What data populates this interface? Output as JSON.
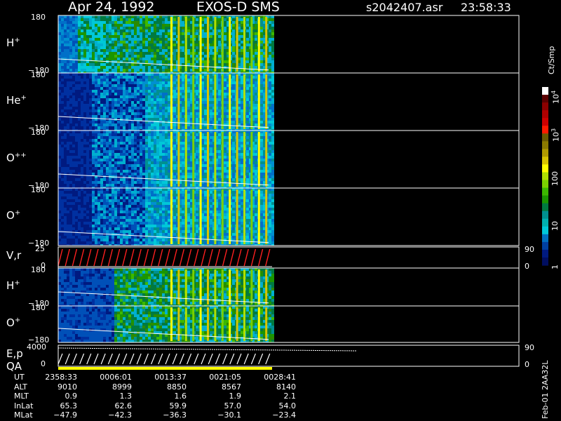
{
  "header": {
    "date": "Apr 24, 1992",
    "instrument": "EXOS-D SMS",
    "file": "s2042407.asr",
    "time": "23:58:33"
  },
  "chart_data": {
    "type": "heatmap",
    "panels": [
      {
        "label_base": "H",
        "label_sup": "+",
        "ytick_top": "180",
        "ytick_bottom": "−180",
        "style": "flux_green"
      },
      {
        "label_base": "He",
        "label_sup": "+",
        "ytick_top": "180",
        "ytick_bottom": "−180",
        "style": "flux_blue"
      },
      {
        "label_base": "O",
        "label_sup": "++",
        "ytick_top": "180",
        "ytick_bottom": "−180",
        "style": "flux_blue"
      },
      {
        "label_base": "O",
        "label_sup": "+",
        "ytick_top": "180",
        "ytick_bottom": "−180",
        "style": "flux_blue"
      },
      {
        "label_base": "V,r",
        "label_sup": "",
        "ytick_top": "25",
        "ytick_bottom": "0",
        "rtick_top": "90",
        "rtick_bottom": "0",
        "style": "line_red"
      },
      {
        "label_base": "H",
        "label_sup": "+",
        "ytick_top": "180",
        "ytick_bottom": "−180",
        "style": "flux_green_low"
      },
      {
        "label_base": "O",
        "label_sup": "+",
        "ytick_top": "180",
        "ytick_bottom": "−180",
        "style": "flux_green_low"
      },
      {
        "label_base": "E,p",
        "label2": "QA",
        "label_sup": "",
        "ytick_top": "4000",
        "ytick_bottom": "0",
        "rtick_top": "90",
        "rtick_bottom": "0",
        "style": "line_white"
      }
    ],
    "colorbar": {
      "unit": "Ct/Smp",
      "ticks": [
        {
          "base": "10",
          "exp": "4",
          "frac": 0.96
        },
        {
          "base": "10",
          "exp": "3",
          "frac": 0.75
        },
        {
          "base": "100",
          "exp": "",
          "frac": 0.5
        },
        {
          "base": "10",
          "exp": "",
          "frac": 0.25
        },
        {
          "base": "1",
          "exp": "",
          "frac": 0.03
        }
      ],
      "colors": [
        "#ffffff",
        "#5a0000",
        "#8b0000",
        "#b00000",
        "#d00000",
        "#ff1a00",
        "#6b5a00",
        "#8b7a00",
        "#b09a00",
        "#d8c400",
        "#ffff00",
        "#b0e000",
        "#7ad000",
        "#3cb800",
        "#1a9600",
        "#007a40",
        "#009090",
        "#00b0b0",
        "#00c8d8",
        "#0070c0",
        "#0040a0",
        "#001a80",
        "#000e60"
      ]
    },
    "ephemeris": {
      "rows": [
        {
          "label": "UT",
          "values": [
            "2358:33",
            "0006:01",
            "0013:37",
            "0021:05",
            "0028:41"
          ]
        },
        {
          "label": "ALT",
          "values": [
            "9010",
            "8999",
            "8850",
            "8567",
            "8140"
          ]
        },
        {
          "label": "MLT",
          "values": [
            "0.9",
            "1.3",
            "1.6",
            "1.9",
            "2.1"
          ]
        },
        {
          "label": "InLat",
          "values": [
            "65.3",
            "62.6",
            "59.9",
            "57.0",
            "54.0"
          ]
        },
        {
          "label": "MLat",
          "values": [
            "−47.9",
            "−42.3",
            "−36.3",
            "−30.1",
            "−23.4"
          ]
        }
      ]
    }
  },
  "side_stamp": "Feb-01 2AA32L"
}
